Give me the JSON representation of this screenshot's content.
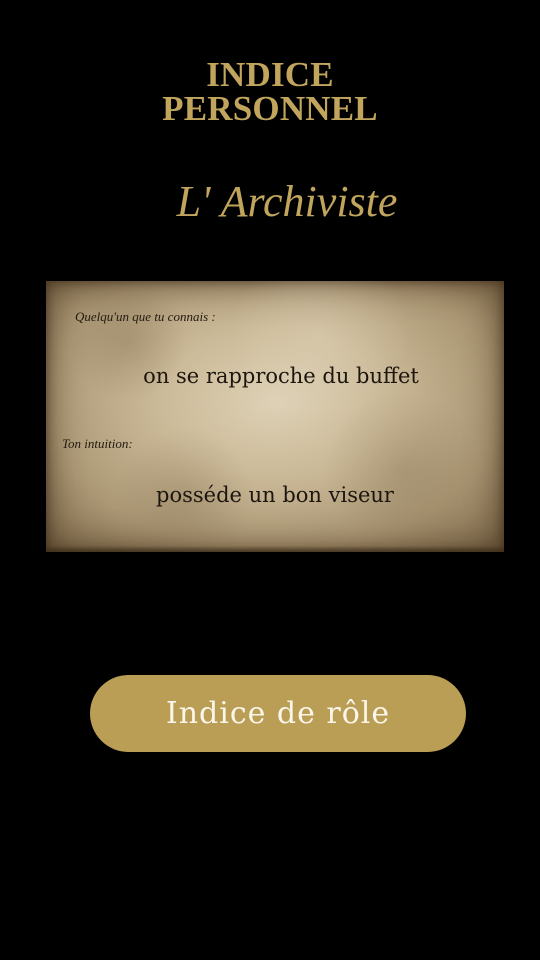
{
  "header": {
    "title_line1": "INDICE",
    "title_line2": "PERSONNEL",
    "character_name": "L' Archiviste"
  },
  "clue_card": {
    "contact_label": "Quelqu'un que tu connais :",
    "contact_clue": "on se rapproche du buffet",
    "intuition_label": "Ton intuition:",
    "intuition_clue": "posséde un bon viseur"
  },
  "actions": {
    "role_clue_button_label": "Indice de rôle"
  },
  "colors": {
    "background": "#000000",
    "gold_accent": "#c1a55d",
    "button_fill": "#ba9e56",
    "button_text": "#fbf6ea",
    "ink": "#1d160e"
  }
}
